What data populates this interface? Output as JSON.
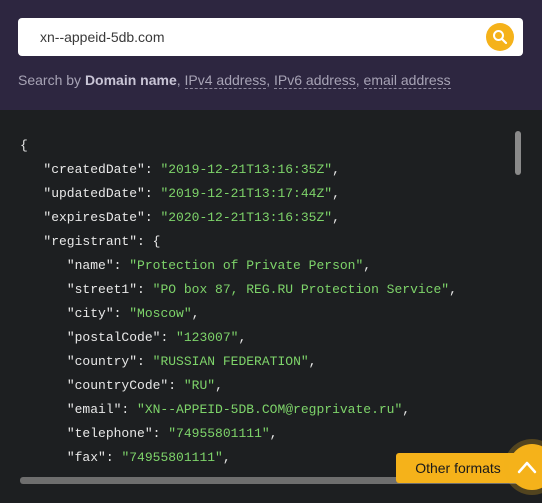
{
  "search": {
    "value": "xn--appeid-5db.com",
    "icon": "search-icon"
  },
  "hint": {
    "prefix": "Search by",
    "domain": "Domain name",
    "sep1": ",",
    "ipv4": "IPv4 address",
    "sep2": ",",
    "ipv6": "IPv6 address",
    "sep3": ",",
    "email": "email address"
  },
  "json": {
    "open": "{",
    "createdDate": {
      "key": "\"createdDate\"",
      "value": "\"2019-12-21T13:16:35Z\""
    },
    "updatedDate": {
      "key": "\"updatedDate\"",
      "value": "\"2019-12-21T13:17:44Z\""
    },
    "expiresDate": {
      "key": "\"expiresDate\"",
      "value": "\"2020-12-21T13:16:35Z\""
    },
    "registrant_key": "\"registrant\"",
    "name": {
      "key": "\"name\"",
      "value": "\"Protection of Private Person\""
    },
    "street1": {
      "key": "\"street1\"",
      "value": "\"PO box 87, REG.RU Protection Service\""
    },
    "city": {
      "key": "\"city\"",
      "value": "\"Moscow\""
    },
    "postalCode": {
      "key": "\"postalCode\"",
      "value": "\"123007\""
    },
    "country": {
      "key": "\"country\"",
      "value": "\"RUSSIAN FEDERATION\""
    },
    "countryCode": {
      "key": "\"countryCode\"",
      "value": "\"RU\""
    },
    "email": {
      "key": "\"email\"",
      "value": "\"XN--APPEID-5DB.COM@regprivate.ru\""
    },
    "telephone": {
      "key": "\"telephone\"",
      "value": "\"74955801111\""
    },
    "fax": {
      "key": "\"fax\"",
      "value": "\"74955801111\""
    }
  },
  "buttons": {
    "other_formats": "Other formats",
    "scroll_top_icon": "chevron-up-icon"
  },
  "colors": {
    "header_bg": "#2d2640",
    "code_bg": "#1d1f21",
    "accent": "#f5b21a",
    "string": "#7ed46a"
  }
}
